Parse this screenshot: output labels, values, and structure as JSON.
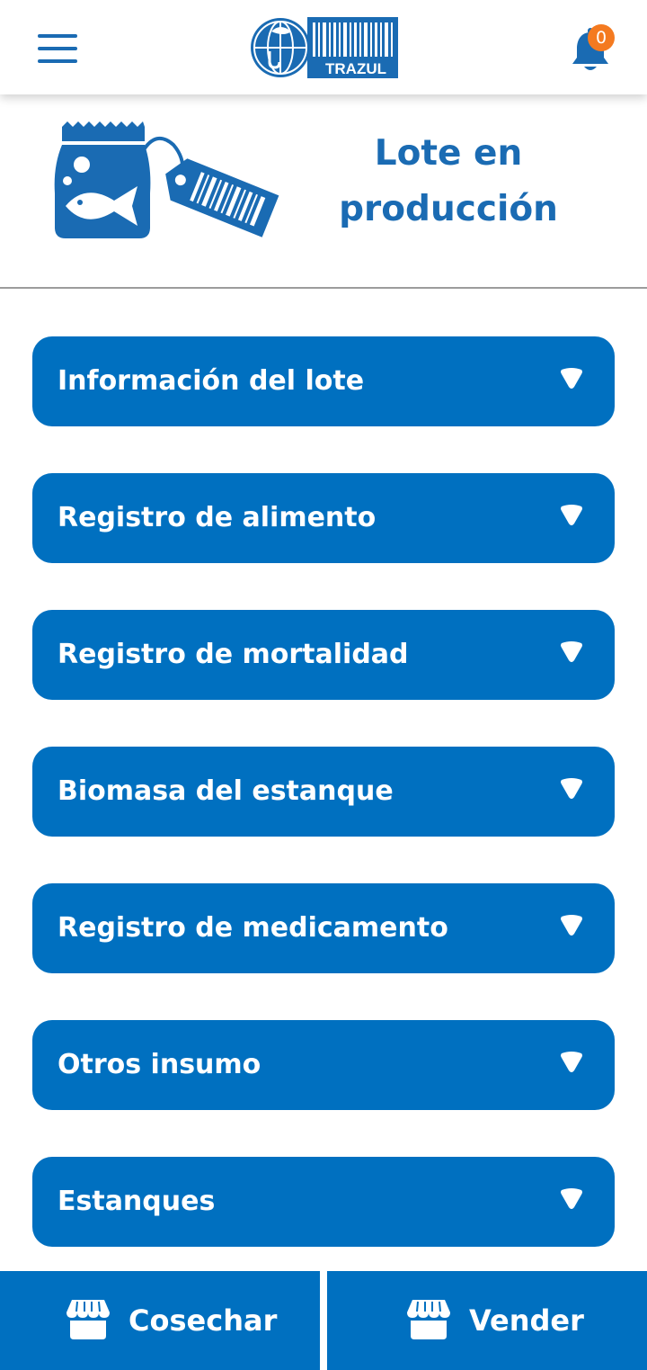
{
  "app": {
    "name": "TRAZUL",
    "accent_color": "#0070c0",
    "title_color": "#1a6bb3",
    "badge_color": "#f47a20"
  },
  "header": {
    "menu_icon": "hamburger-menu-icon",
    "notification_icon": "bell-icon",
    "notification_count": "0"
  },
  "hero": {
    "illustration": "fish-bag-with-barcode-tag",
    "title_line1": "Lote en",
    "title_line2": "producción"
  },
  "sections": [
    {
      "label": "Información del lote",
      "icon": "triangle-down-icon"
    },
    {
      "label": "Registro de alimento",
      "icon": "triangle-down-icon"
    },
    {
      "label": "Registro de mortalidad",
      "icon": "triangle-down-icon"
    },
    {
      "label": "Biomasa del estanque",
      "icon": "triangle-down-icon"
    },
    {
      "label": "Registro de medicamento",
      "icon": "triangle-down-icon"
    },
    {
      "label": "Otros insumo",
      "icon": "triangle-down-icon"
    },
    {
      "label": "Estanques",
      "icon": "triangle-down-icon"
    }
  ],
  "footer": {
    "harvest_label": "Cosechar",
    "sell_label": "Vender",
    "harvest_icon": "store-icon",
    "sell_icon": "store-icon"
  }
}
